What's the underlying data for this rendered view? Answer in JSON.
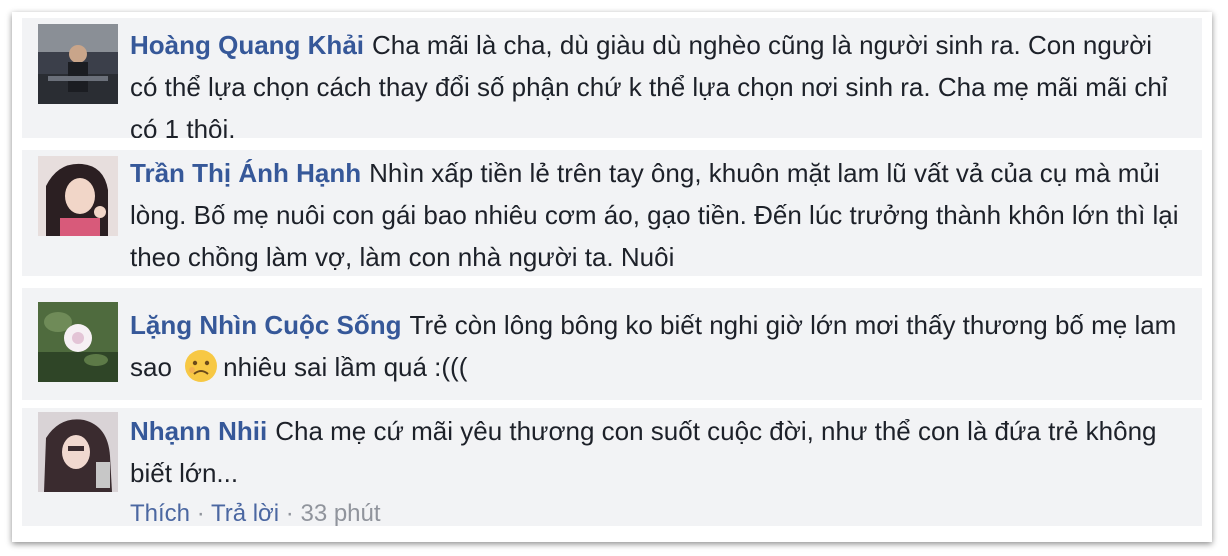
{
  "comments": [
    {
      "author": "Hoàng Quang Khải",
      "text": "Cha mãi là cha, dù giàu dù nghèo cũng là người sinh ra. Con người có thể lựa chọn cách thay đổi số phận chứ k thể lựa chọn nơi sinh ra. Cha mẹ mãi mãi chỉ có 1 thôi."
    },
    {
      "author": "Trần Thị Ánh Hạnh",
      "text": "Nhìn xấp tiền lẻ trên tay ông, khuôn mặt lam lũ vất vả của cụ mà mủi lòng. Bố mẹ nuôi con gái bao nhiêu cơm áo, gạo tiền. Đến lúc trưởng thành khôn lớn thì lại theo chồng làm vợ, làm con nhà người ta. Nuôi"
    },
    {
      "author": "Lặng Nhìn Cuộc Sống",
      "text_before_emoji": "Trẻ còn lông bông ko biết nghi giờ lớn mơi thấy thương bố mẹ lam sao",
      "emoji": "sad-face-emoji",
      "text_after_emoji": "nhiêu sai lầm quá :((("
    },
    {
      "author": "Nhạnn Nhii",
      "text": "Cha mẹ cứ mãi yêu thương con suốt cuộc đời, như thể con là đứa trẻ không biết lớn...",
      "actions": {
        "like": "Thích",
        "reply": "Trả lời",
        "separator": "·",
        "time": "33 phút"
      }
    }
  ],
  "colors": {
    "author": "#365899",
    "text": "#1d2129",
    "bubble": "#f2f3f5",
    "meta": "#90949c"
  }
}
